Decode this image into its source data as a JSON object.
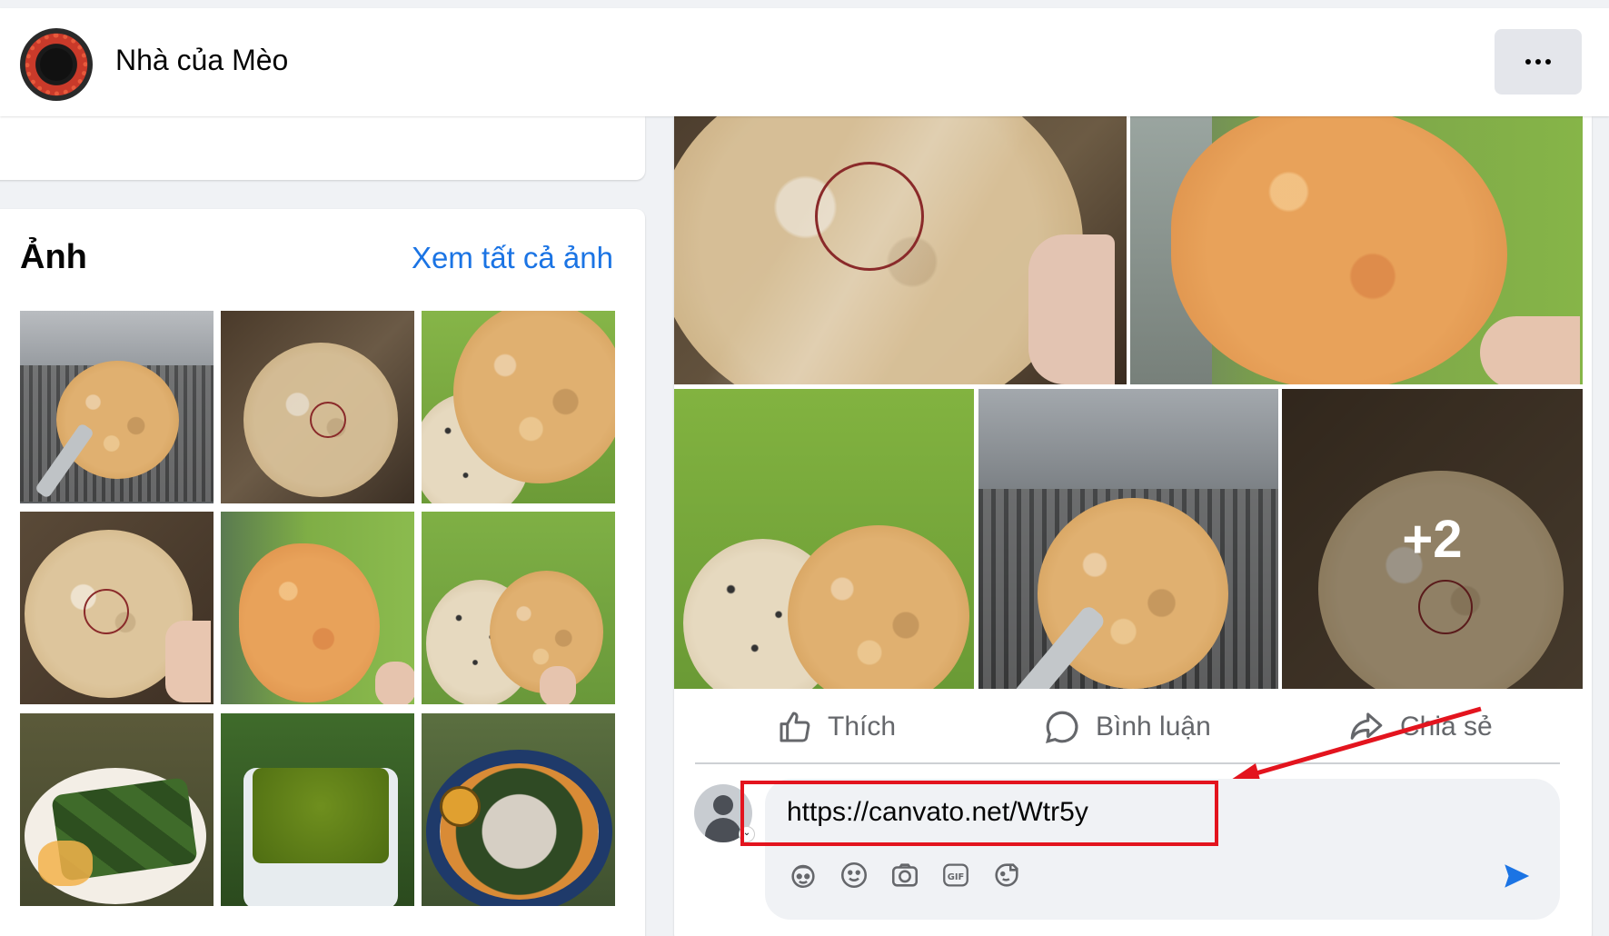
{
  "header": {
    "page_name": "Nhà của Mèo",
    "more_label": "..."
  },
  "photos": {
    "title": "Ảnh",
    "see_all": "Xem tất cả ảnh"
  },
  "post": {
    "more_count": "+2",
    "actions": {
      "like": "Thích",
      "comment": "Bình luận",
      "share": "Chia sẻ"
    }
  },
  "comment": {
    "value": "https://canvato.net/Wtr5y"
  },
  "colors": {
    "accent": "#1b74e4",
    "highlight": "#e3141e",
    "icon_gray": "#65676b"
  },
  "icons": [
    "more-icon",
    "like-icon",
    "comment-icon",
    "share-icon",
    "avatar-sticker-icon",
    "emoji-icon",
    "camera-icon",
    "gif-icon",
    "sticker-icon",
    "send-icon"
  ]
}
